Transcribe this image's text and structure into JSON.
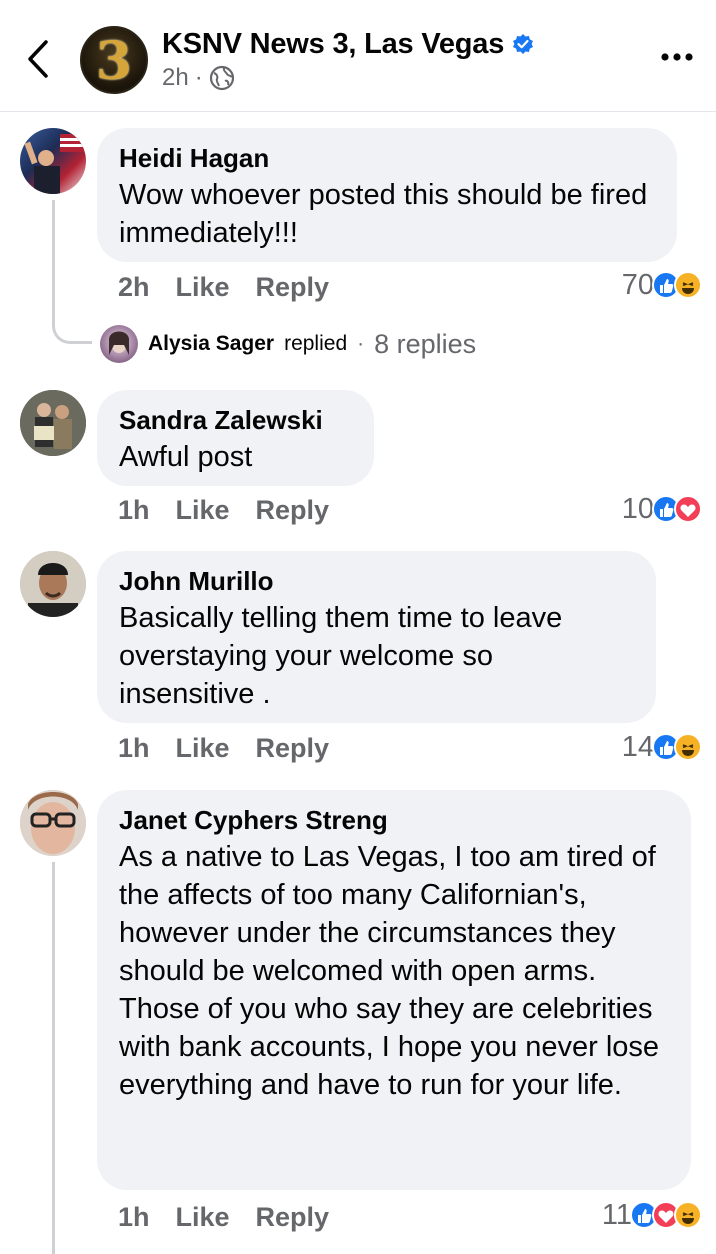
{
  "header": {
    "page_name": "KSNV News 3, Las Vegas",
    "time": "2h",
    "separator": "·",
    "avatar_text": "3",
    "icons": [
      "chevron-left-icon",
      "verified-badge-icon",
      "globe-icon",
      "more-dots-icon"
    ]
  },
  "comments": [
    {
      "name": "Heidi Hagan",
      "text": "Wow whoever posted this should be fired immediately!!!",
      "time": "2h",
      "like_label": "Like",
      "reply_label": "Reply",
      "reaction_count": "70",
      "reactions": [
        "like",
        "haha"
      ],
      "replies": {
        "name": "Alysia Sager",
        "label": "replied",
        "separator": "·",
        "count": "8 replies"
      }
    },
    {
      "name": "Sandra Zalewski",
      "text": "Awful post",
      "time": "1h",
      "like_label": "Like",
      "reply_label": "Reply",
      "reaction_count": "10",
      "reactions": [
        "like",
        "love"
      ]
    },
    {
      "name": "John Murillo",
      "text": "Basically telling them time to leave overstaying your welcome so insensitive .",
      "time": "1h",
      "like_label": "Like",
      "reply_label": "Reply",
      "reaction_count": "14",
      "reactions": [
        "like",
        "haha"
      ]
    },
    {
      "name": "Janet Cyphers Streng",
      "text": "As a native to  Las Vegas, I too am tired of the affects of too many Californian's, however under the circumstances they should be welcomed with open arms. Those of you who say they are celebrities with bank accounts, I hope you never lose everything and have to run for your life.",
      "time": "1h",
      "like_label": "Like",
      "reply_label": "Reply",
      "reaction_count": "11",
      "reactions": [
        "like",
        "love",
        "haha"
      ]
    }
  ],
  "colors": {
    "bubble": "#f0f2f5",
    "secondary_text": "#65676b",
    "facebook_blue": "#1877f2",
    "love_red": "#f33e58",
    "haha_yellow": "#f7b125"
  }
}
